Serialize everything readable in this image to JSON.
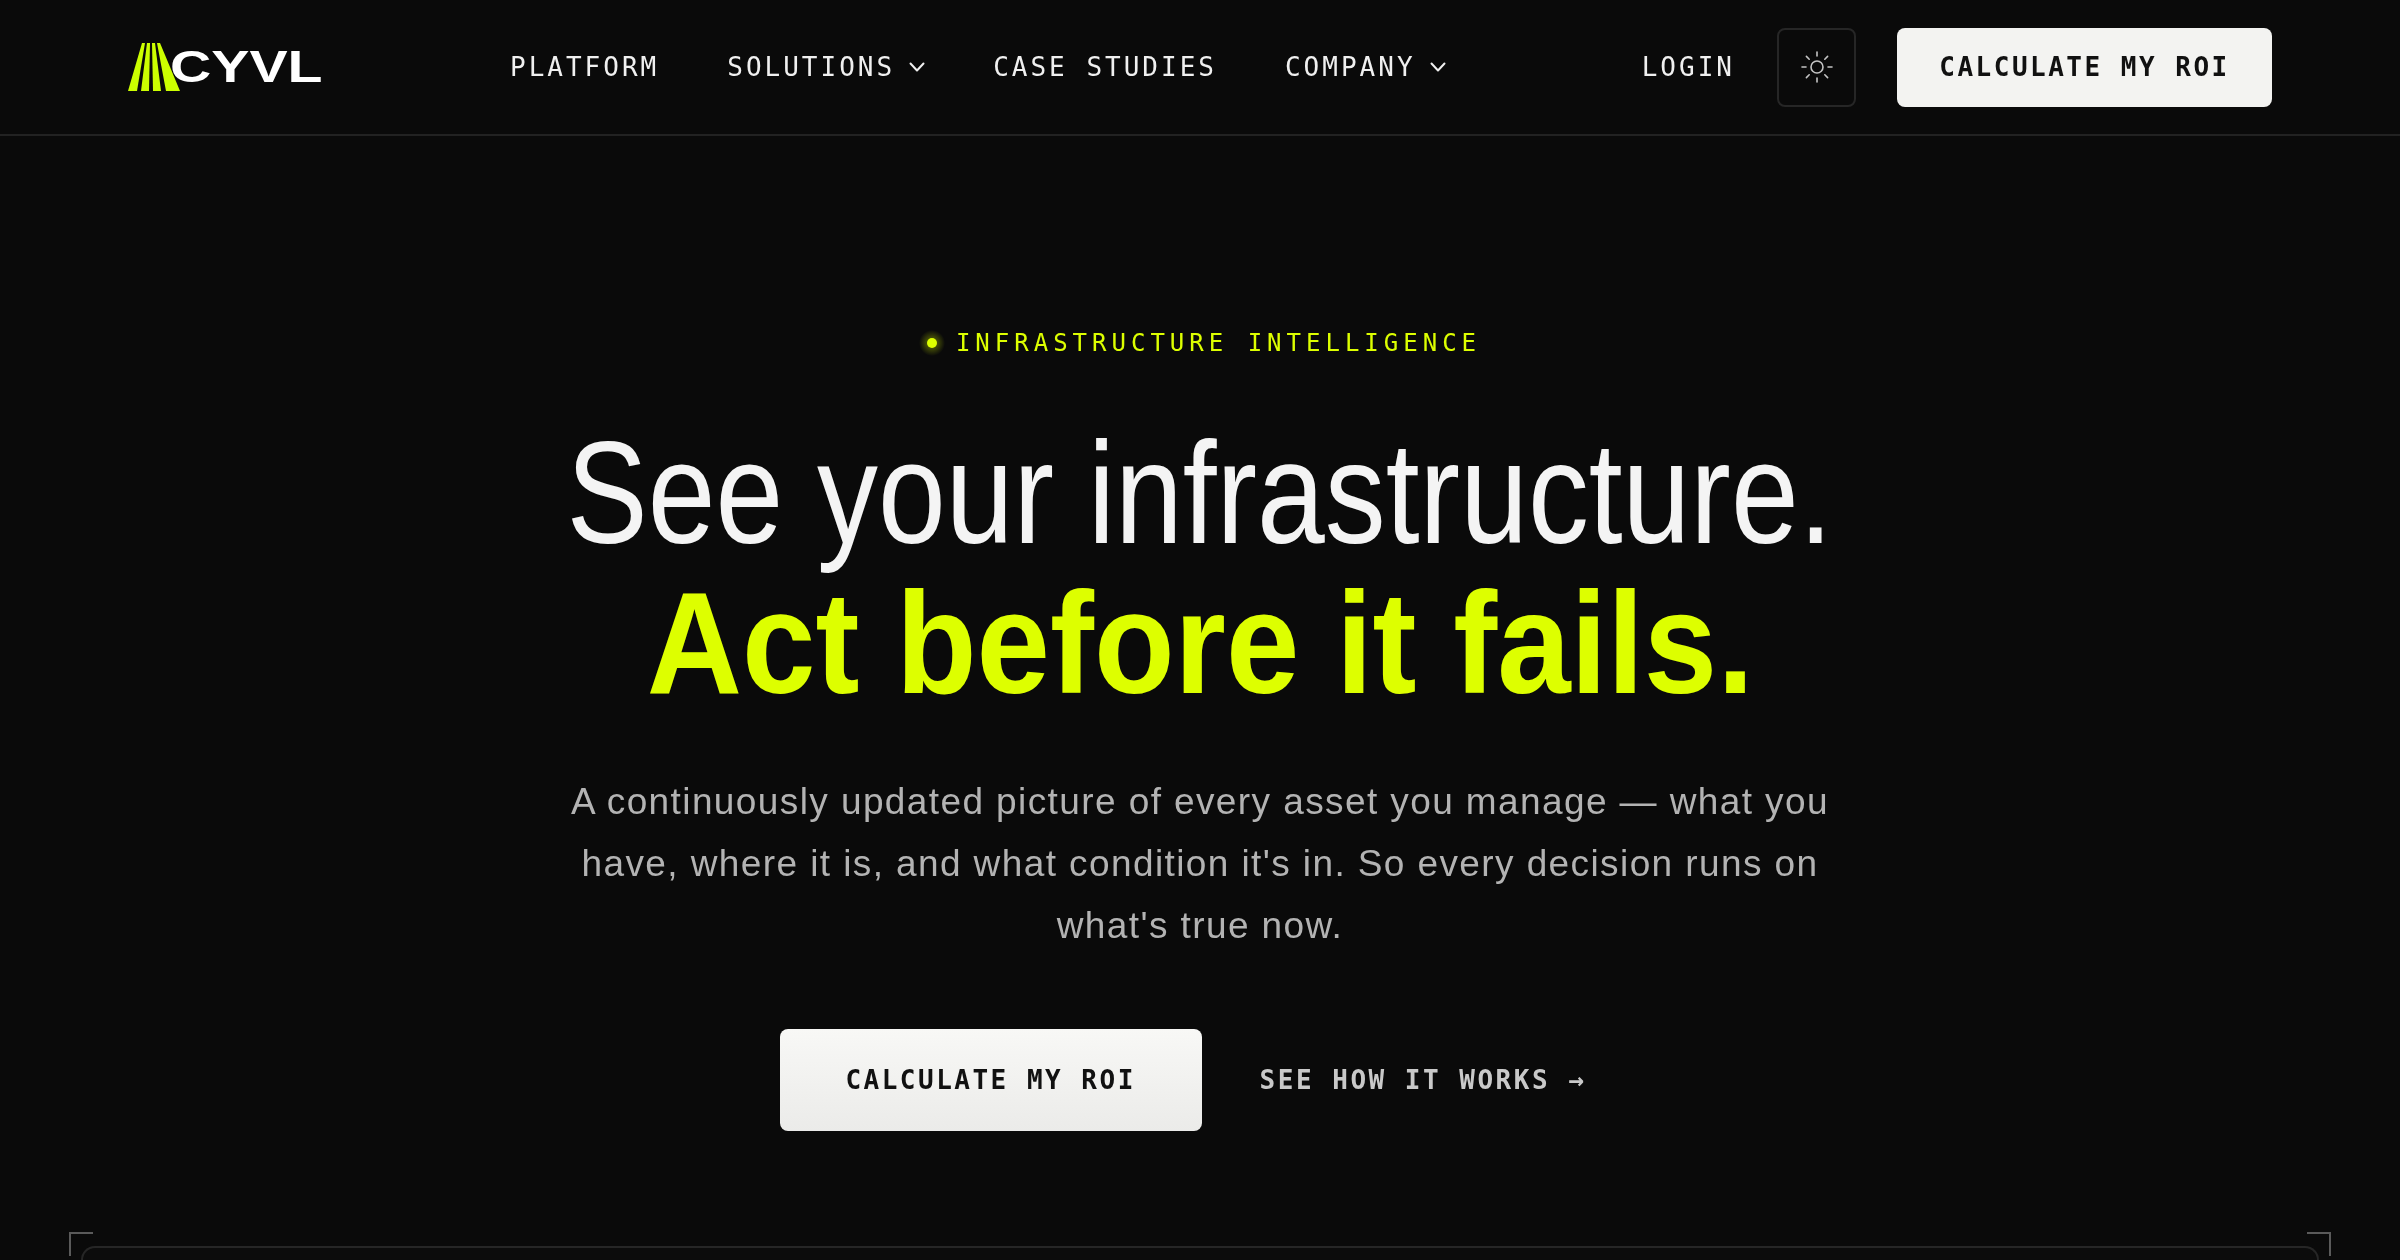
{
  "header": {
    "logo": {
      "text": "CYVL"
    },
    "nav": [
      {
        "label": "PLATFORM",
        "dropdown": false
      },
      {
        "label": "SOLUTIONS",
        "dropdown": true
      },
      {
        "label": "CASE STUDIES",
        "dropdown": false
      },
      {
        "label": "COMPANY",
        "dropdown": true
      }
    ],
    "login": "LOGIN",
    "cta": "CALCULATE MY ROI"
  },
  "hero": {
    "eyebrow": "INFRASTRUCTURE INTELLIGENCE",
    "headline": "See your infrastructure.",
    "headline_accent": "Act before it fails.",
    "description": "A continuously updated picture of every asset you manage — what you have, where it is, and what condition it's in. So every decision runs on what's true now.",
    "primary_button": "CALCULATE MY ROI",
    "secondary_link": "SEE HOW IT WORKS →"
  }
}
